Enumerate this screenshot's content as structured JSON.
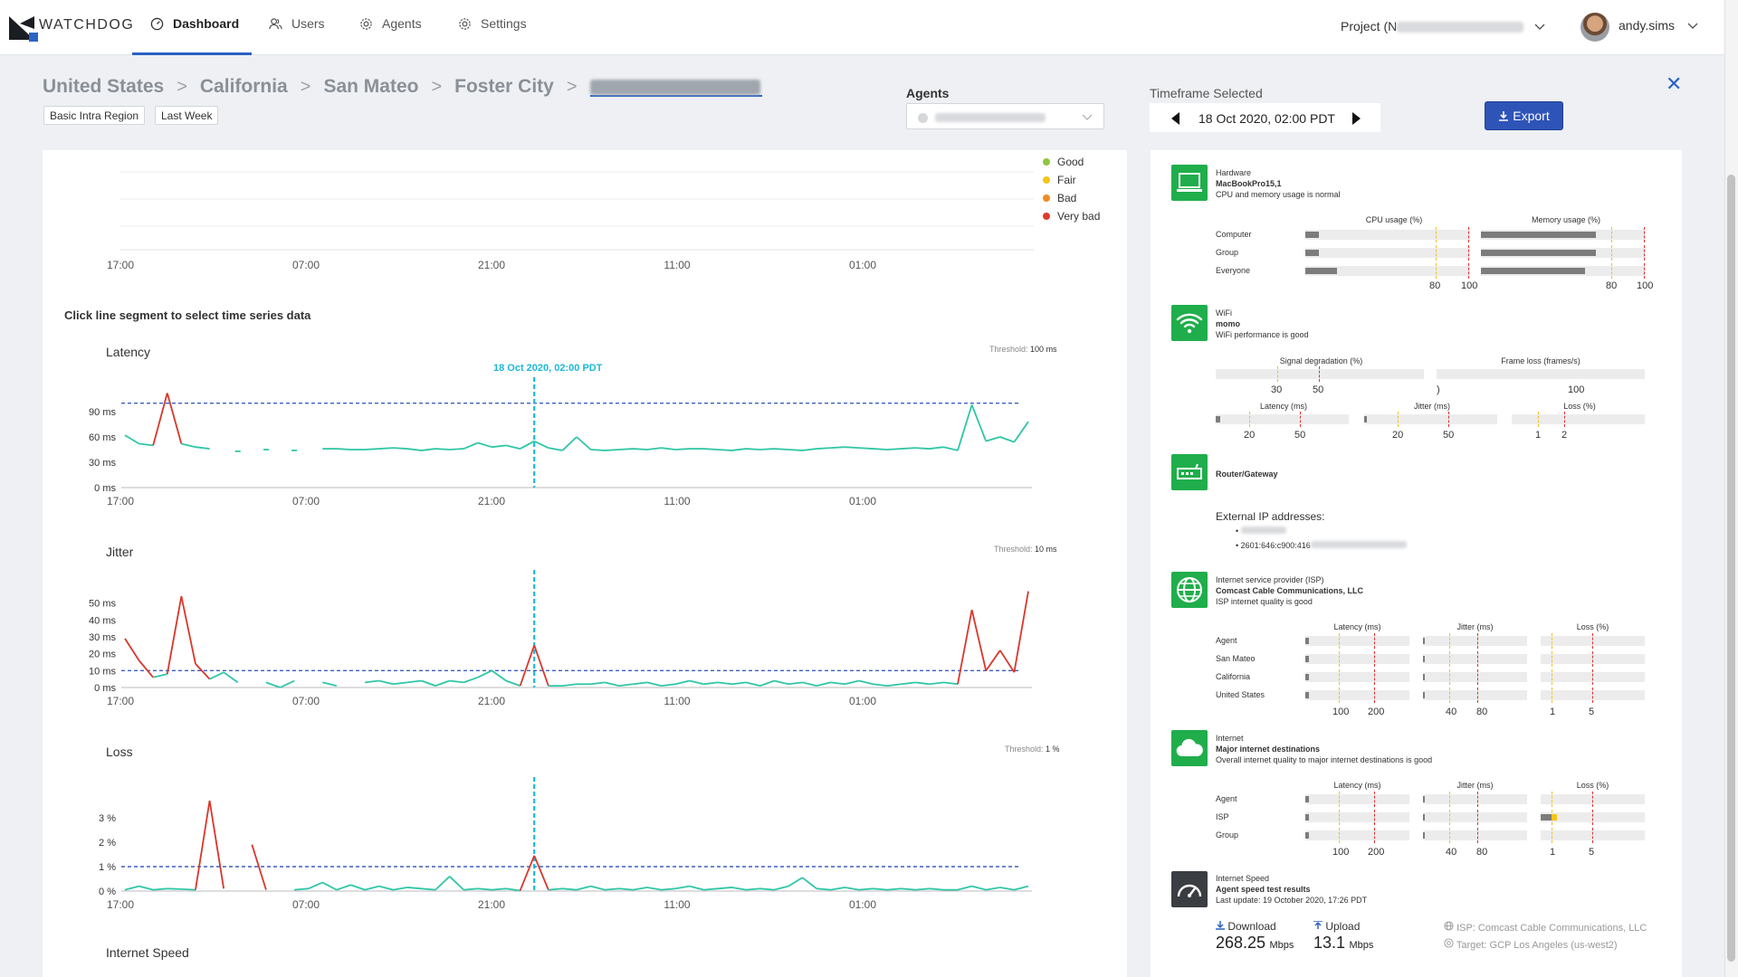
{
  "app": {
    "logo_text": "WATCHDOG"
  },
  "nav": {
    "items": [
      {
        "label": "Dashboard",
        "icon": "dashboard-icon"
      },
      {
        "label": "Users",
        "icon": "users-icon"
      },
      {
        "label": "Agents",
        "icon": "gear-icon"
      },
      {
        "label": "Settings",
        "icon": "gear-icon"
      }
    ],
    "active": "Dashboard",
    "project_label": "Project (N",
    "username": "andy.sims"
  },
  "breadcrumb": {
    "items": [
      "United States",
      "California",
      "San Mateo",
      "Foster City"
    ],
    "chips": [
      "Basic Intra Region",
      "Last Week"
    ]
  },
  "controls": {
    "agents_label": "Agents",
    "timeframe_label": "Timeframe Selected",
    "timeframe_value": "18 Oct 2020, 02:00 PDT",
    "export_label": "Export"
  },
  "legend": {
    "items": [
      {
        "label": "Good",
        "color": "#8dc63f"
      },
      {
        "label": "Fair",
        "color": "#f5c518"
      },
      {
        "label": "Bad",
        "color": "#f08a24"
      },
      {
        "label": "Very bad",
        "color": "#e03a2f"
      }
    ]
  },
  "charts_section": {
    "instruction": "Click line segment to select time series data",
    "time_ticks": [
      "17:00",
      "07:00",
      "21:00",
      "11:00",
      "01:00"
    ],
    "selected_marker": "18 Oct 2020, 02:00 PDT",
    "internet_speed_label": "Internet Speed"
  },
  "chart_data": [
    {
      "type": "line",
      "title": "Latency",
      "threshold_label": "Threshold:",
      "threshold_value_text": "100 ms",
      "threshold": 100,
      "y_ticks": [
        "90 ms",
        "60 ms",
        "30 ms",
        "0 ms"
      ],
      "ylim": [
        0,
        120
      ],
      "x_ticks": [
        "17:00",
        "07:00",
        "21:00",
        "11:00",
        "01:00"
      ],
      "values": [
        62,
        52,
        50,
        112,
        52,
        48,
        46,
        null,
        43,
        null,
        45,
        null,
        44,
        null,
        46,
        46,
        45,
        45,
        46,
        47,
        46,
        44,
        46,
        45,
        46,
        53,
        48,
        50,
        46,
        55,
        47,
        44,
        60,
        45,
        44,
        45,
        46,
        45,
        47,
        45,
        46,
        46,
        45,
        44,
        46,
        45,
        46,
        45,
        44,
        46,
        47,
        48,
        47,
        46,
        45,
        46,
        47,
        46,
        48,
        44,
        98,
        55,
        60,
        54,
        78
      ]
    },
    {
      "type": "line",
      "title": "Jitter",
      "threshold_label": "Threshold:",
      "threshold_value_text": "10 ms",
      "threshold": 10,
      "y_ticks": [
        "50 ms",
        "40 ms",
        "30 ms",
        "20 ms",
        "10 ms",
        "0 ms"
      ],
      "ylim": [
        0,
        60
      ],
      "x_ticks": [
        "17:00",
        "07:00",
        "21:00",
        "11:00",
        "01:00"
      ],
      "values": [
        29,
        16,
        6,
        8,
        54,
        14,
        5,
        9,
        3,
        null,
        3,
        0,
        4,
        null,
        3,
        1,
        null,
        3,
        4,
        2,
        3,
        4,
        1,
        4,
        3,
        6,
        10,
        4,
        1,
        25,
        1,
        1,
        2,
        2,
        3,
        1,
        2,
        3,
        1,
        2,
        4,
        2,
        3,
        2,
        3,
        1,
        4,
        2,
        3,
        1,
        3,
        2,
        4,
        2,
        1,
        2,
        3,
        2,
        3,
        2,
        46,
        10,
        22,
        9,
        57
      ]
    },
    {
      "type": "line",
      "title": "Loss",
      "threshold_label": "Threshold:",
      "threshold_value_text": "1 %",
      "threshold": 1,
      "y_ticks": [
        "3 %",
        "2 %",
        "1 %",
        "0 %"
      ],
      "ylim": [
        0,
        4
      ],
      "x_ticks": [
        "17:00",
        "07:00",
        "21:00",
        "11:00",
        "01:00"
      ],
      "values": [
        0.05,
        0.2,
        0.05,
        0.1,
        0.08,
        0.05,
        3.7,
        0.1,
        null,
        1.9,
        0.05,
        null,
        0.05,
        0.1,
        0.35,
        0.05,
        0.25,
        0.05,
        0.2,
        0.05,
        0.15,
        0.1,
        0.05,
        0.6,
        0.05,
        0.1,
        0.05,
        0.1,
        0.02,
        1.45,
        0.05,
        0.1,
        0.05,
        0.2,
        0.05,
        0.1,
        0.05,
        0.15,
        0.05,
        0.1,
        0.2,
        0.05,
        0.1,
        0.15,
        0.05,
        0.1,
        0.05,
        0.2,
        0.55,
        0.1,
        0.05,
        0.15,
        0.05,
        0.1,
        0.05,
        0.1,
        0.05,
        0.1,
        0.05,
        0.05,
        0.2,
        0.05,
        0.15,
        0.05,
        0.2
      ]
    }
  ],
  "hardware": {
    "title": "Hardware",
    "model": "MacBookPro15,1",
    "status": "CPU and memory usage is normal",
    "cpu_header": "CPU usage (%)",
    "mem_header": "Memory usage (%)",
    "rows": [
      {
        "label": "Computer",
        "cpu": 0.08,
        "mem": 0.7
      },
      {
        "label": "Group",
        "cpu": 0.08,
        "mem": 0.7
      },
      {
        "label": "Everyone",
        "cpu": 0.19,
        "mem": 0.63
      }
    ],
    "axis": [
      "80",
      "100"
    ]
  },
  "wifi": {
    "title": "WiFi",
    "name": "momo",
    "status": "WiFi performance is good",
    "signal_header": "Signal degradation (%)",
    "signal_axis": [
      "30",
      "50"
    ],
    "frame_header": "Frame loss (frames/s)",
    "frame_axis_left": ")",
    "frame_axis": "100",
    "latency_header": "Latency (ms)",
    "latency_axis": [
      "20",
      "50"
    ],
    "jitter_header": "Jitter (ms)",
    "jitter_axis": [
      "20",
      "50"
    ],
    "loss_header": "Loss (%)",
    "loss_axis": [
      "1",
      "2"
    ]
  },
  "router": {
    "title": "Router/Gateway",
    "ext_ip_label": "External IP addresses:",
    "ip2": "2601:646:c900:416"
  },
  "isp": {
    "title": "Internet service provider (ISP)",
    "name": "Comcast Cable Communications, LLC",
    "status": "ISP internet quality is good",
    "latency_header": "Latency (ms)",
    "jitter_header": "Jitter (ms)",
    "loss_header": "Loss (%)",
    "rows": [
      "Agent",
      "San Mateo",
      "California",
      "United States"
    ],
    "latency_axis": [
      "100",
      "200"
    ],
    "jitter_axis": [
      "40",
      "80"
    ],
    "loss_axis": [
      "1",
      "5"
    ]
  },
  "internet": {
    "title": "Internet",
    "name": "Major internet destinations",
    "status": "Overall internet quality to major internet destinations is good",
    "latency_header": "Latency (ms)",
    "jitter_header": "Jitter (ms)",
    "loss_header": "Loss (%)",
    "rows": [
      "Agent",
      "ISP",
      "Group"
    ],
    "latency_axis": [
      "100",
      "200"
    ],
    "jitter_axis": [
      "40",
      "80"
    ],
    "loss_axis": [
      "1",
      "5"
    ]
  },
  "speed": {
    "title": "Internet Speed",
    "subtitle": "Agent speed test results",
    "last_update": "Last update: 19 October 2020, 17:26 PDT",
    "download_label": "Download",
    "download_value": "268.25",
    "upload_label": "Upload",
    "upload_value": "13.1",
    "unit": "Mbps",
    "isp_text": "ISP: Comcast Cable Communications, LLC",
    "target_text": "Target: GCP Los Angeles (us-west2)"
  }
}
